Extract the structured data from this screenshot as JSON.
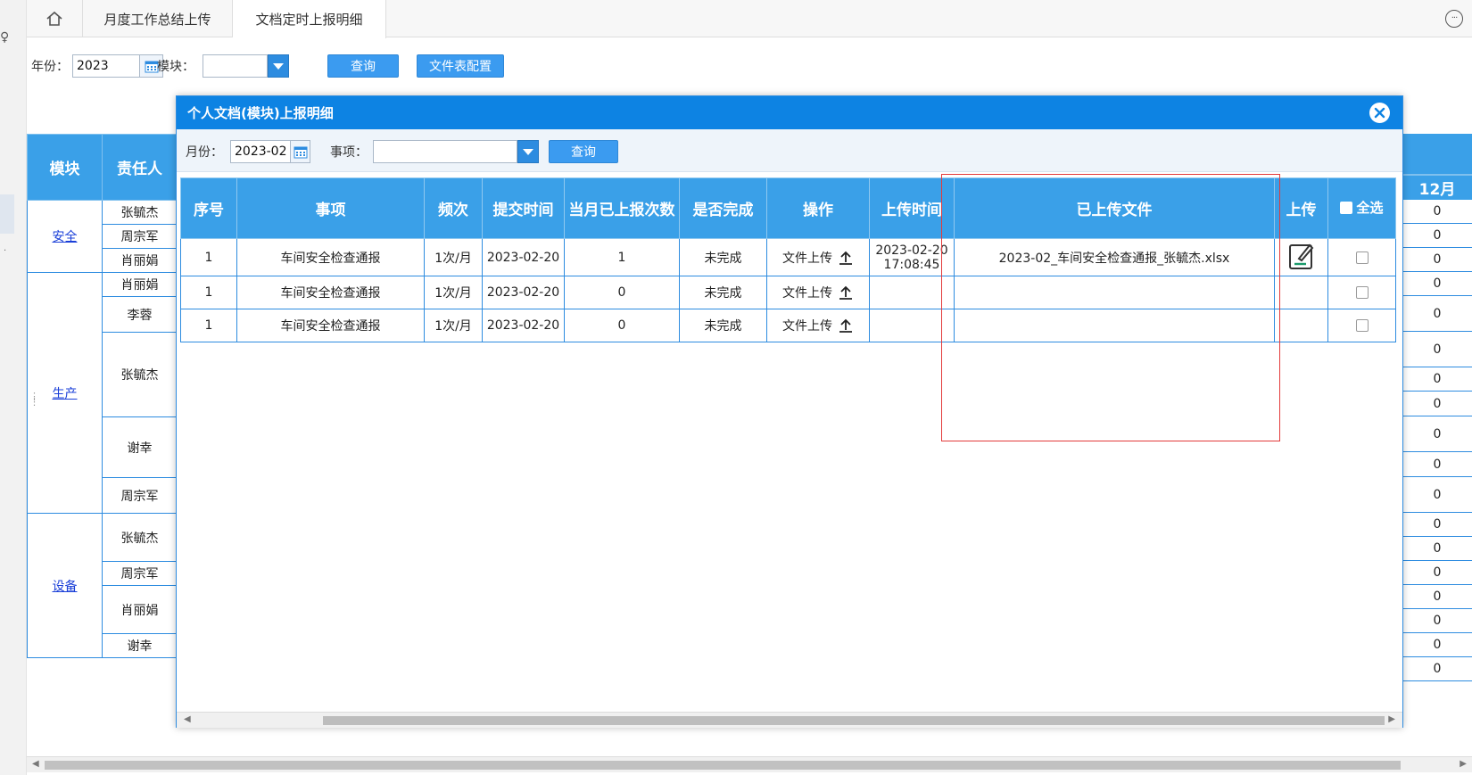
{
  "tabs": {
    "home_icon": "home-icon",
    "items": [
      {
        "label": "月度工作总结上传"
      },
      {
        "label": "文档定时上报明细"
      }
    ]
  },
  "filter": {
    "year_label": "年份：",
    "year_value": "2023",
    "module_label": "模块：",
    "module_value": "",
    "query_button": "查询",
    "config_button": "文件表配置"
  },
  "background_table": {
    "headers": {
      "module": "模块",
      "owner": "责任人",
      "month12": "12月"
    },
    "groups": [
      {
        "module": "安全",
        "rows": [
          "张毓杰",
          "周宗军",
          "肖丽娟"
        ]
      },
      {
        "module": "生产",
        "rows": [
          "肖丽娟",
          "李蓉",
          "张毓杰",
          "谢幸",
          "周宗军"
        ]
      },
      {
        "module": "设备",
        "rows": [
          "张毓杰",
          "周宗军",
          "肖丽娟",
          "谢幸"
        ]
      }
    ],
    "month12_values": [
      "0",
      "0",
      "0",
      "0",
      "0",
      "0",
      "0",
      "0",
      "0",
      "0",
      "0",
      "0",
      "0",
      "0",
      "0",
      "0",
      "0",
      "0"
    ]
  },
  "modal": {
    "title": "个人文档(模块)上报明细",
    "month_label": "月份：",
    "month_value": "2023-02",
    "item_label": "事项：",
    "item_value": "",
    "query_button": "查询",
    "columns": [
      "序号",
      "事项",
      "频次",
      "提交时间",
      "当月已上报次数",
      "是否完成",
      "操作",
      "上传时间",
      "已上传文件",
      "上传",
      "全选"
    ],
    "rows": [
      {
        "no": "1",
        "item": "车间安全检查通报",
        "freq": "1次/月",
        "submit": "2023-02-20",
        "count": "1",
        "done": "未完成",
        "op": "文件上传",
        "upload_time_date": "2023-02-20",
        "upload_time_clock": "17:08:45",
        "file": "2023-02_车间安全检查通报_张毓杰.xlsx"
      },
      {
        "no": "1",
        "item": "车间安全检查通报",
        "freq": "1次/月",
        "submit": "2023-02-20",
        "count": "0",
        "done": "未完成",
        "op": "文件上传",
        "upload_time_date": "",
        "upload_time_clock": "",
        "file": ""
      },
      {
        "no": "1",
        "item": "车间安全检查通报",
        "freq": "1次/月",
        "submit": "2023-02-20",
        "count": "0",
        "done": "未完成",
        "op": "文件上传",
        "upload_time_date": "",
        "upload_time_clock": "",
        "file": ""
      }
    ]
  },
  "colors": {
    "header_blue": "#3aa0e8",
    "modal_title_blue": "#0d83e3",
    "button_blue": "#3b9bf0",
    "highlight_red": "#e33a3a",
    "link_blue": "#1a3fd8"
  }
}
